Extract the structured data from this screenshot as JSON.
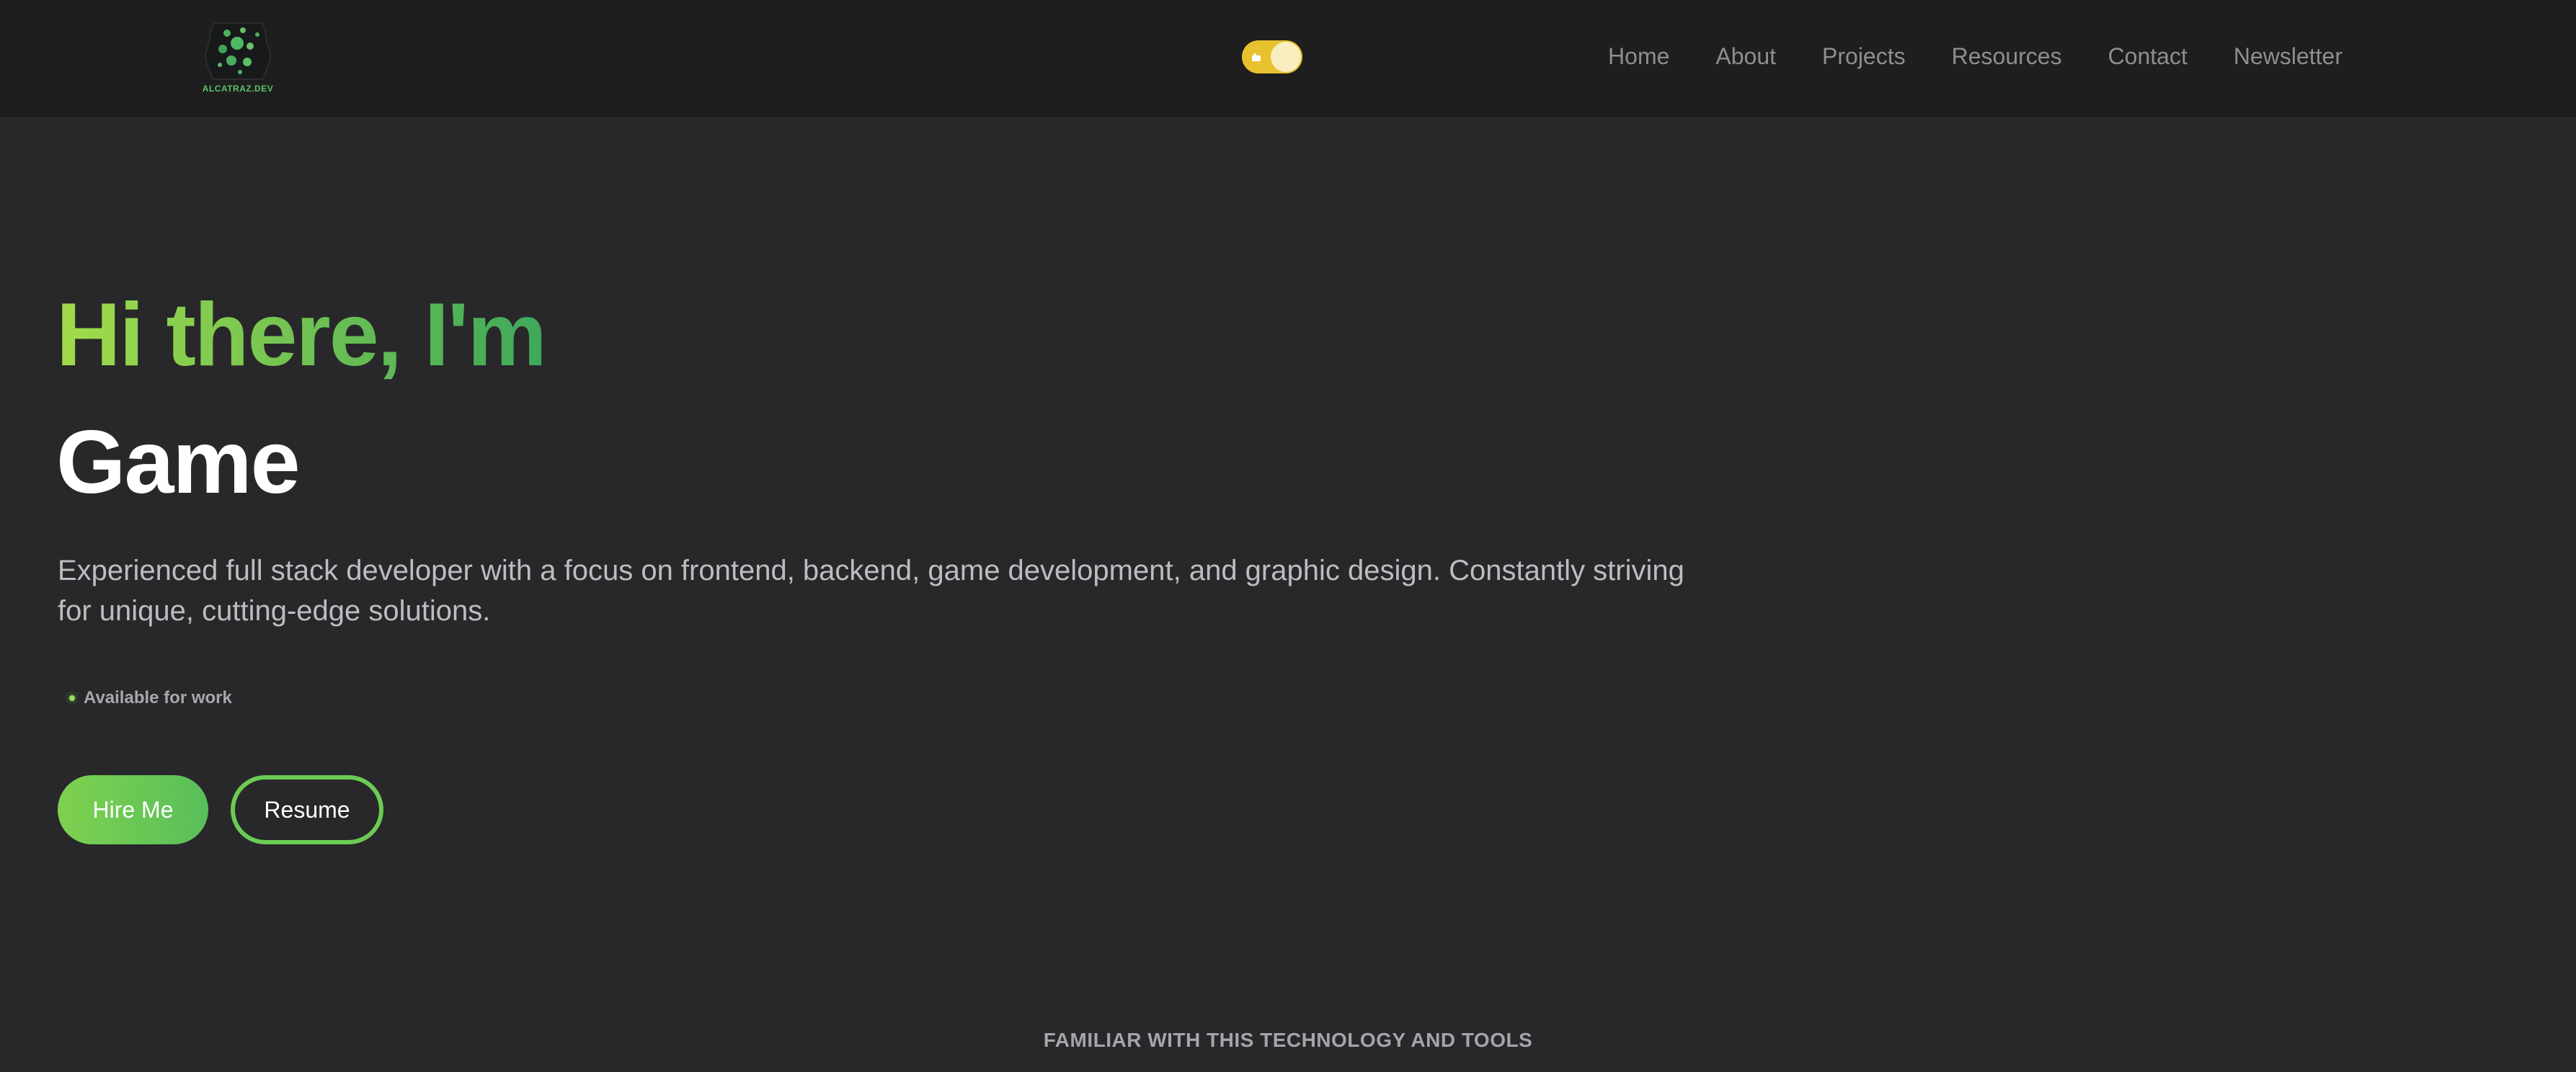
{
  "brand": {
    "logo_text": "ALCATRAZ.DEV"
  },
  "theme_toggle": {
    "icon": "sun-icon",
    "state": "light"
  },
  "nav": {
    "items": [
      {
        "label": "Home"
      },
      {
        "label": "About"
      },
      {
        "label": "Projects"
      },
      {
        "label": "Resources"
      },
      {
        "label": "Contact"
      },
      {
        "label": "Newsletter"
      }
    ]
  },
  "hero": {
    "greeting": "Hi there, I'm",
    "role": "Game",
    "description": "Experienced full stack developer with a focus on frontend, backend, game development, and graphic design. Constantly striving for unique, cutting-edge solutions.",
    "status": "Available for work",
    "hire_label": "Hire Me",
    "resume_label": "Resume"
  },
  "tech": {
    "heading": "FAMILIAR WITH THIS TECHNOLOGY AND TOOLS"
  },
  "colors": {
    "background": "#28282a",
    "navbar": "#1e1e1f",
    "accent_light": "#a3dc4b",
    "accent_dark": "#3ea85a",
    "toggle": "#e8c12e"
  }
}
